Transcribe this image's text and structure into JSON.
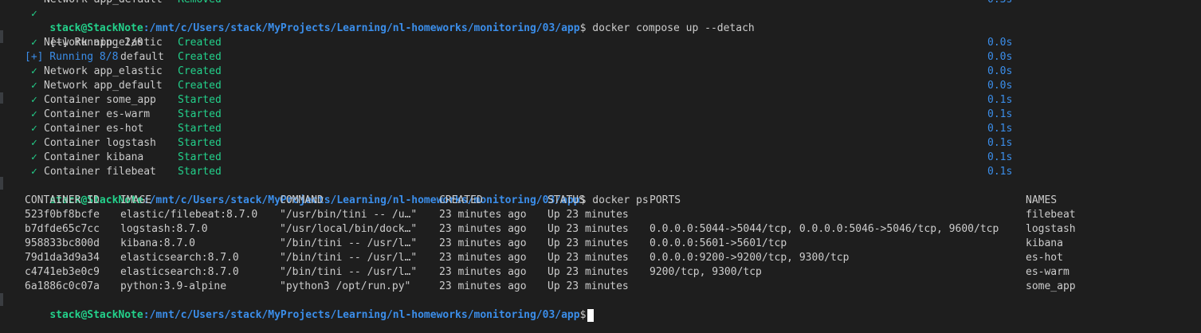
{
  "prompt": {
    "user": "stack@StackNote",
    "path": ":/mnt/c/Users/stack/MyProjects/Learning/nl-homeworks/monitoring/03/app",
    "symbol": "$"
  },
  "partial_line": {
    "name": "Network app_default",
    "status": "Removed",
    "time": "0.3s"
  },
  "commands": {
    "compose_up": "docker compose up --detach",
    "docker_ps": "docker ps"
  },
  "running_1": {
    "label": "[+] Running 2/0"
  },
  "running_2": {
    "label": "[+] Running 8/8",
    "suffix": "default"
  },
  "check_glyph": "✓",
  "compose_rows": [
    {
      "name": "Network app_elastic",
      "status": "Created",
      "time": "0.0s"
    },
    {
      "name": "Network app_elastic",
      "status": "Created",
      "time": "0.0s"
    },
    {
      "name": "Network app_default",
      "status": "Created",
      "time": "0.0s"
    },
    {
      "name": "Container some_app",
      "status": "Started",
      "time": "0.1s"
    },
    {
      "name": "Container es-warm",
      "status": "Started",
      "time": "0.1s"
    },
    {
      "name": "Container es-hot",
      "status": "Started",
      "time": "0.1s"
    },
    {
      "name": "Container logstash",
      "status": "Started",
      "time": "0.1s"
    },
    {
      "name": "Container kibana",
      "status": "Started",
      "time": "0.1s"
    },
    {
      "name": "Container filebeat",
      "status": "Started",
      "time": "0.1s"
    }
  ],
  "ps_headers": {
    "container_id": "CONTAINER ID",
    "image": "IMAGE",
    "command": "COMMAND",
    "created": "CREATED",
    "status": "STATUS",
    "ports": "PORTS",
    "names": "NAMES"
  },
  "ps_rows": [
    {
      "container_id": "523f0bf8bcfe",
      "image": "elastic/filebeat:8.7.0",
      "command": "\"/usr/bin/tini -- /u…\"",
      "created": "23 minutes ago",
      "status": "Up 23 minutes",
      "ports": "",
      "names": "filebeat"
    },
    {
      "container_id": "b7dfde65c7cc",
      "image": "logstash:8.7.0",
      "command": "\"/usr/local/bin/dock…\"",
      "created": "23 minutes ago",
      "status": "Up 23 minutes",
      "ports": "0.0.0.0:5044->5044/tcp, 0.0.0.0:5046->5046/tcp, 9600/tcp",
      "names": "logstash"
    },
    {
      "container_id": "958833bc800d",
      "image": "kibana:8.7.0",
      "command": "\"/bin/tini -- /usr/l…\"",
      "created": "23 minutes ago",
      "status": "Up 23 minutes",
      "ports": "0.0.0.0:5601->5601/tcp",
      "names": "kibana"
    },
    {
      "container_id": "79d1da3d9a34",
      "image": "elasticsearch:8.7.0",
      "command": "\"/bin/tini -- /usr/l…\"",
      "created": "23 minutes ago",
      "status": "Up 23 minutes",
      "ports": "0.0.0.0:9200->9200/tcp, 9300/tcp",
      "names": "es-hot"
    },
    {
      "container_id": "c4741eb3e0c9",
      "image": "elasticsearch:8.7.0",
      "command": "\"/bin/tini -- /usr/l…\"",
      "created": "23 minutes ago",
      "status": "Up 23 minutes",
      "ports": "9200/tcp, 9300/tcp",
      "names": "es-warm"
    },
    {
      "container_id": "6a1886c0c07a",
      "image": "python:3.9-alpine",
      "command": "\"python3 /opt/run.py\"",
      "created": "23 minutes ago",
      "status": "Up 23 minutes",
      "ports": "",
      "names": "some_app"
    }
  ],
  "colors": {
    "background": "#1e1e1e",
    "text": "#cccccc",
    "green": "#23d18b",
    "blue": "#3b8eea"
  }
}
